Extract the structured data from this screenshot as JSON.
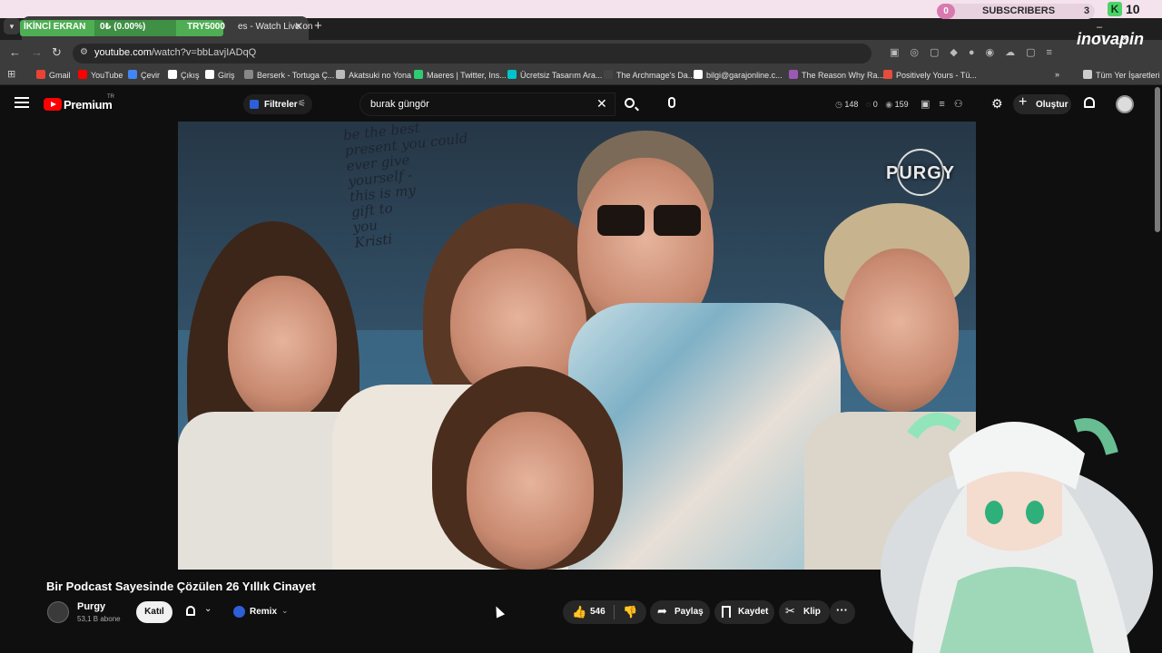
{
  "browser": {
    "tab_title": "es - Watch Live on",
    "url_host": "youtube.com",
    "url_path": "/watch?v=bbLavjIADqQ",
    "profile_brand": "inovapin"
  },
  "stream_overlay": {
    "screen_label": "İKİNCİ EKRAN",
    "progress_text": "0₺ (0.00%)",
    "goal_text": "TRY5000",
    "subs_left": "0",
    "subs_label": "SUBSCRIBERS",
    "subs_count": "3",
    "k_icon": "K",
    "k_count": "10"
  },
  "bookmarks": [
    {
      "label": "Gmail",
      "color": "#ea4335"
    },
    {
      "label": "YouTube",
      "color": "#ff0000"
    },
    {
      "label": "Çevir",
      "color": "#4285f4"
    },
    {
      "label": "Çıkış",
      "color": "#ffffff"
    },
    {
      "label": "Giriş",
      "color": "#ffffff"
    },
    {
      "label": "Berserk - Tortuga Ç...",
      "color": "#888888"
    },
    {
      "label": "Akatsuki no Yona",
      "color": "#bbbbbb"
    },
    {
      "label": "Maeres | Twitter, Ins...",
      "color": "#2ecc71"
    },
    {
      "label": "Ücretsiz Tasarım Ara...",
      "color": "#00c4cc"
    },
    {
      "label": "The Archmage's Da...",
      "color": "#444444"
    },
    {
      "label": "bilgi@garajonline.c...",
      "color": "#ffffff"
    },
    {
      "label": "The Reason Why Ra...",
      "color": "#9b59b6"
    },
    {
      "label": "Positively Yours - Tü...",
      "color": "#e74c3c"
    },
    {
      "label": "Tüm Yer İşaretleri",
      "color": "#cccccc"
    }
  ],
  "youtube": {
    "brand": "Premium",
    "region": "TR",
    "filters_label": "Filtreler",
    "search_value": "burak güngör",
    "stats": {
      "a": "148",
      "b": "0",
      "c": "159"
    },
    "create_label": "Oluştur"
  },
  "video": {
    "handwriting": [
      "be the best",
      "present you could",
      "ever give",
      "yourself -",
      "this is my",
      "gift to",
      "you",
      "Kristi"
    ],
    "watermark": "PURGY",
    "title": "Bir Podcast Sayesinde Çözülen 26 Yıllık Cinayet",
    "channel_name": "Purgy",
    "channel_subs": "53,1 B abone",
    "join_label": "Katıl",
    "remix_label": "Remix",
    "like_count": "546",
    "share_label": "Paylaş",
    "save_label": "Kaydet",
    "clip_label": "Klip"
  }
}
